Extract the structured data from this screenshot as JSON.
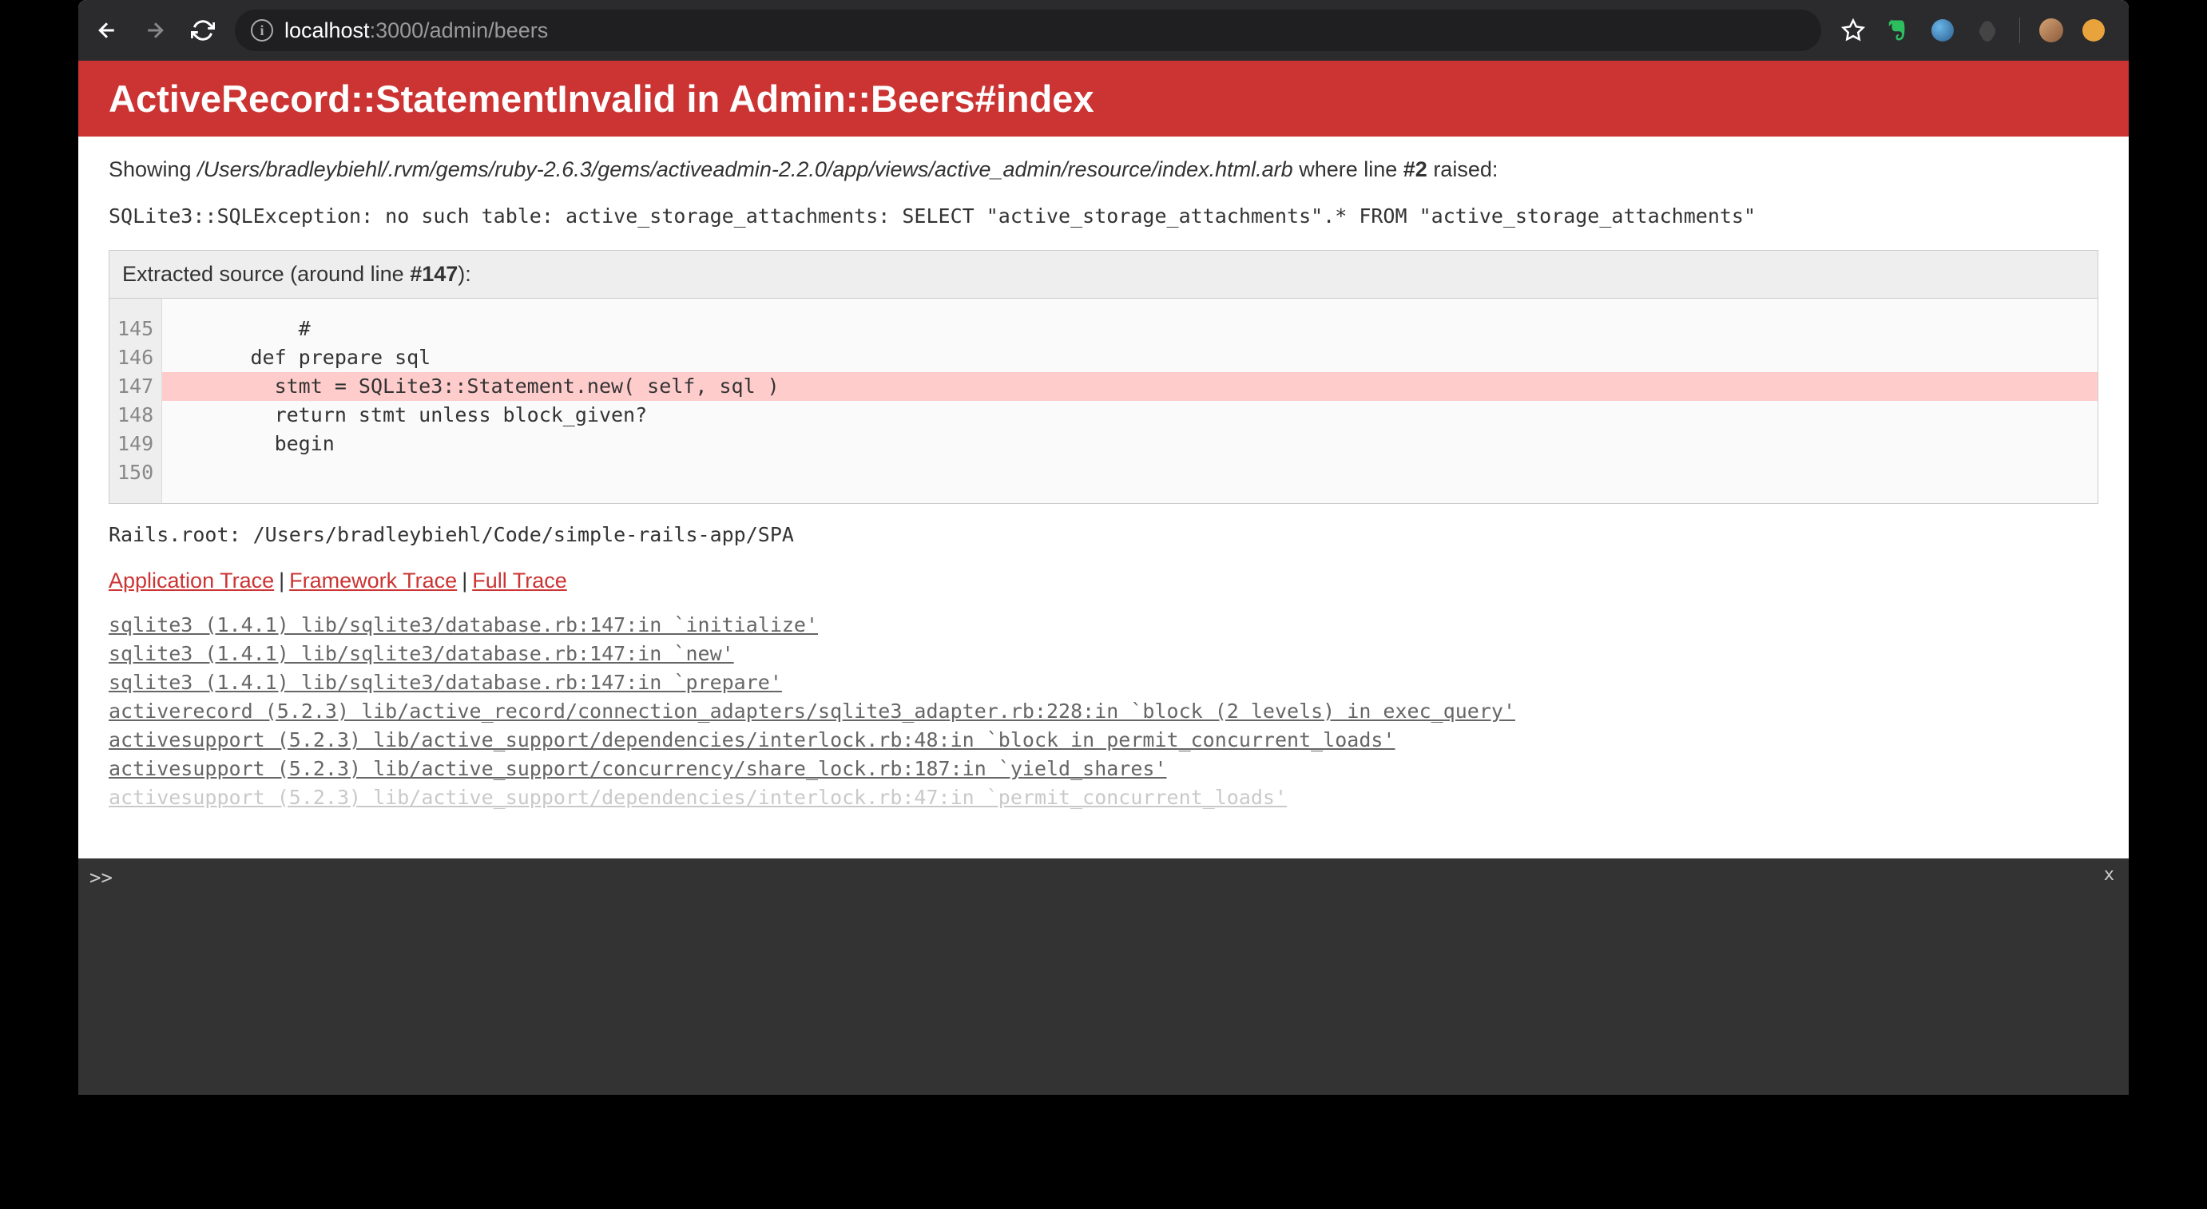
{
  "browser": {
    "url_host": "localhost",
    "url_path": ":3000/admin/beers"
  },
  "error": {
    "title": "ActiveRecord::StatementInvalid in Admin::Beers#index",
    "showing_prefix": "Showing ",
    "showing_path": "/Users/bradleybiehl/.rvm/gems/ruby-2.6.3/gems/activeadmin-2.2.0/app/views/active_admin/resource/index.html.arb",
    "showing_mid": " where line ",
    "showing_line": "#2",
    "showing_suffix": " raised:",
    "sql_error": "SQLite3::SQLException: no such table: active_storage_attachments: SELECT \"active_storage_attachments\".* FROM \"active_storage_attachments\"",
    "source_header_prefix": "Extracted source (around line ",
    "source_header_line": "#147",
    "source_header_suffix": "):",
    "line_numbers": [
      "145",
      "146",
      "147",
      "148",
      "149",
      "150"
    ],
    "code_lines": {
      "l0": "          #",
      "l1": "      def prepare sql",
      "l2": "        stmt = SQLite3::Statement.new( self, sql )",
      "l3": "        return stmt unless block_given?",
      "l4": "",
      "l5": "        begin"
    },
    "rails_root": "Rails.root: /Users/bradleybiehl/Code/simple-rails-app/SPA",
    "trace_tabs": {
      "app": "Application Trace",
      "framework": "Framework Trace",
      "full": "Full Trace"
    },
    "traces": [
      "sqlite3 (1.4.1) lib/sqlite3/database.rb:147:in `initialize'",
      "sqlite3 (1.4.1) lib/sqlite3/database.rb:147:in `new'",
      "sqlite3 (1.4.1) lib/sqlite3/database.rb:147:in `prepare'",
      "activerecord (5.2.3) lib/active_record/connection_adapters/sqlite3_adapter.rb:228:in `block (2 levels) in exec_query'",
      "activesupport (5.2.3) lib/active_support/dependencies/interlock.rb:48:in `block in permit_concurrent_loads'",
      "activesupport (5.2.3) lib/active_support/concurrency/share_lock.rb:187:in `yield_shares'",
      "activesupport (5.2.3) lib/active_support/dependencies/interlock.rb:47:in `permit_concurrent_loads'"
    ]
  },
  "console": {
    "prompt": ">>",
    "close": "x"
  }
}
